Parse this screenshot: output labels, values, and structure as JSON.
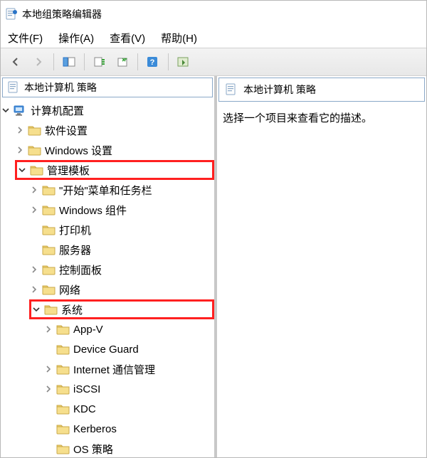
{
  "window": {
    "title": "本地组策略编辑器"
  },
  "menu": {
    "file": "文件(F)",
    "action": "操作(A)",
    "view": "查看(V)",
    "help": "帮助(H)"
  },
  "tree": {
    "root_label": "本地计算机 策略",
    "nodes": [
      {
        "id": "computer-config",
        "label": "计算机配置",
        "icon": "computer",
        "expanded": true,
        "children": [
          {
            "id": "software-settings",
            "label": "软件设置",
            "icon": "folder",
            "expanded": false,
            "hasChildren": true
          },
          {
            "id": "windows-settings",
            "label": "Windows 设置",
            "icon": "folder",
            "expanded": false,
            "hasChildren": true
          },
          {
            "id": "admin-templates",
            "label": "管理模板",
            "icon": "folder",
            "expanded": true,
            "highlight": true,
            "children": [
              {
                "id": "start-taskbar",
                "label": "\"开始\"菜单和任务栏",
                "icon": "folder",
                "expanded": false,
                "hasChildren": true
              },
              {
                "id": "windows-components",
                "label": "Windows 组件",
                "icon": "folder",
                "expanded": false,
                "hasChildren": true
              },
              {
                "id": "printer",
                "label": "打印机",
                "icon": "folder",
                "expanded": false,
                "hasChildren": false
              },
              {
                "id": "server",
                "label": "服务器",
                "icon": "folder",
                "expanded": false,
                "hasChildren": false
              },
              {
                "id": "control-panel",
                "label": "控制面板",
                "icon": "folder",
                "expanded": false,
                "hasChildren": true
              },
              {
                "id": "network",
                "label": "网络",
                "icon": "folder",
                "expanded": false,
                "hasChildren": true
              },
              {
                "id": "system",
                "label": "系统",
                "icon": "folder",
                "expanded": true,
                "highlight": true,
                "children": [
                  {
                    "id": "app-v",
                    "label": "App-V",
                    "icon": "folder",
                    "expanded": false,
                    "hasChildren": true
                  },
                  {
                    "id": "device-guard",
                    "label": "Device Guard",
                    "icon": "folder",
                    "expanded": false,
                    "hasChildren": false
                  },
                  {
                    "id": "internet-comm",
                    "label": "Internet 通信管理",
                    "icon": "folder",
                    "expanded": false,
                    "hasChildren": true
                  },
                  {
                    "id": "iscsi",
                    "label": "iSCSI",
                    "icon": "folder",
                    "expanded": false,
                    "hasChildren": true
                  },
                  {
                    "id": "kdc",
                    "label": "KDC",
                    "icon": "folder",
                    "expanded": false,
                    "hasChildren": false
                  },
                  {
                    "id": "kerberos",
                    "label": "Kerberos",
                    "icon": "folder",
                    "expanded": false,
                    "hasChildren": false
                  },
                  {
                    "id": "os-policy",
                    "label": "OS 策略",
                    "icon": "folder",
                    "expanded": false,
                    "hasChildren": false
                  }
                ]
              }
            ]
          }
        ]
      }
    ]
  },
  "details": {
    "header": "本地计算机 策略",
    "body": "选择一个项目来查看它的描述。"
  },
  "toolbar": {
    "back": "back",
    "forward": "forward",
    "up": "up",
    "show_hide": "show-hide-tree",
    "export": "export-list",
    "properties": "properties",
    "help": "help",
    "filter": "filter"
  }
}
